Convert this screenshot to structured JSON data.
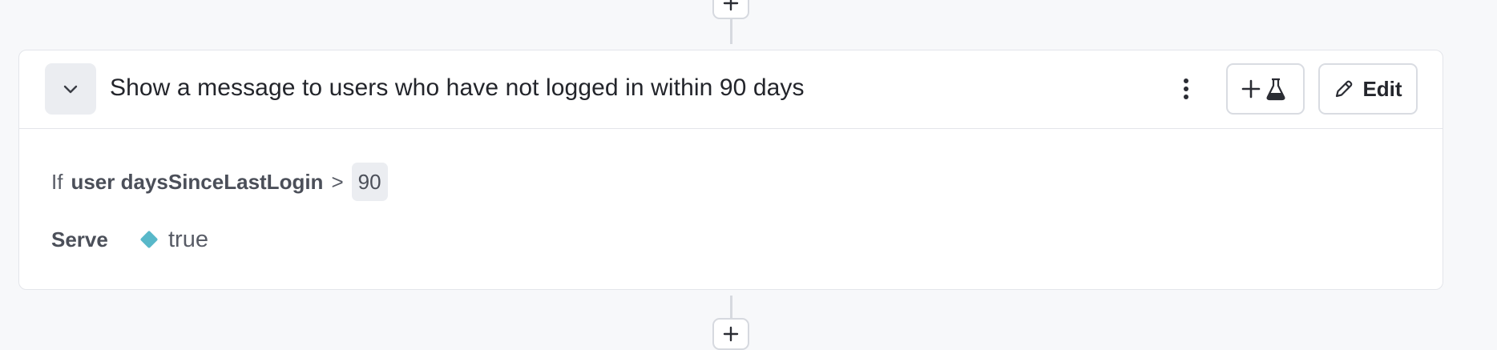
{
  "top_connector": {
    "add_label": "+"
  },
  "rule": {
    "title": "Show a message to users who have not logged in within 90 days",
    "actions": {
      "more_options_icon": "vertical-dots-icon",
      "experiment_button_icons": [
        "plus-icon",
        "flask-icon"
      ],
      "edit_label": "Edit",
      "edit_icon": "pencil-icon"
    },
    "condition": {
      "keyword": "If",
      "attribute": "user daysSinceLastLogin",
      "operator": ">",
      "value": "90"
    },
    "serve": {
      "label": "Serve",
      "variation": "true",
      "variation_color": "#58b8c9"
    }
  },
  "bottom_connector": {
    "add_label": "+"
  }
}
